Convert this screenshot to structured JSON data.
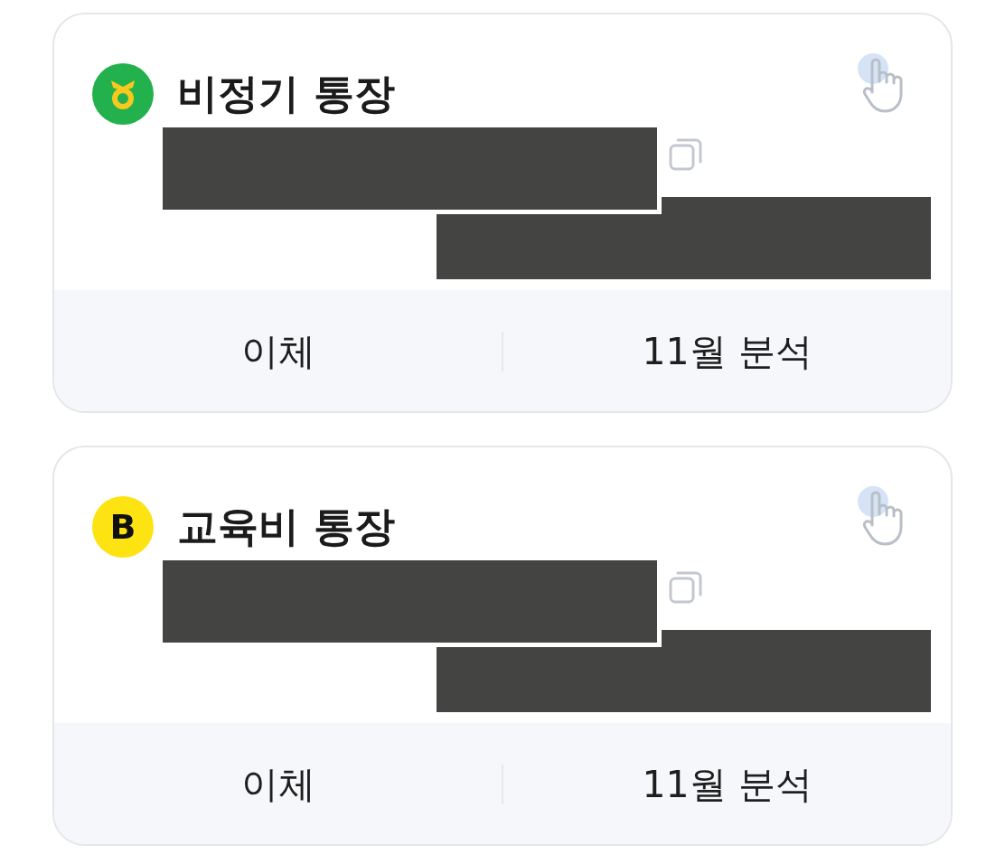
{
  "accounts": [
    {
      "logo": {
        "kind": "ring",
        "color": "#22b14c"
      },
      "title": "비정기 통장",
      "actions": [
        {
          "label": "이체"
        },
        {
          "label": "11월 분석"
        }
      ]
    },
    {
      "logo": {
        "kind": "letter",
        "text": "B",
        "color": "#fde312"
      },
      "title": "교육비 통장",
      "actions": [
        {
          "label": "이체"
        },
        {
          "label": "11월 분석"
        }
      ]
    }
  ]
}
